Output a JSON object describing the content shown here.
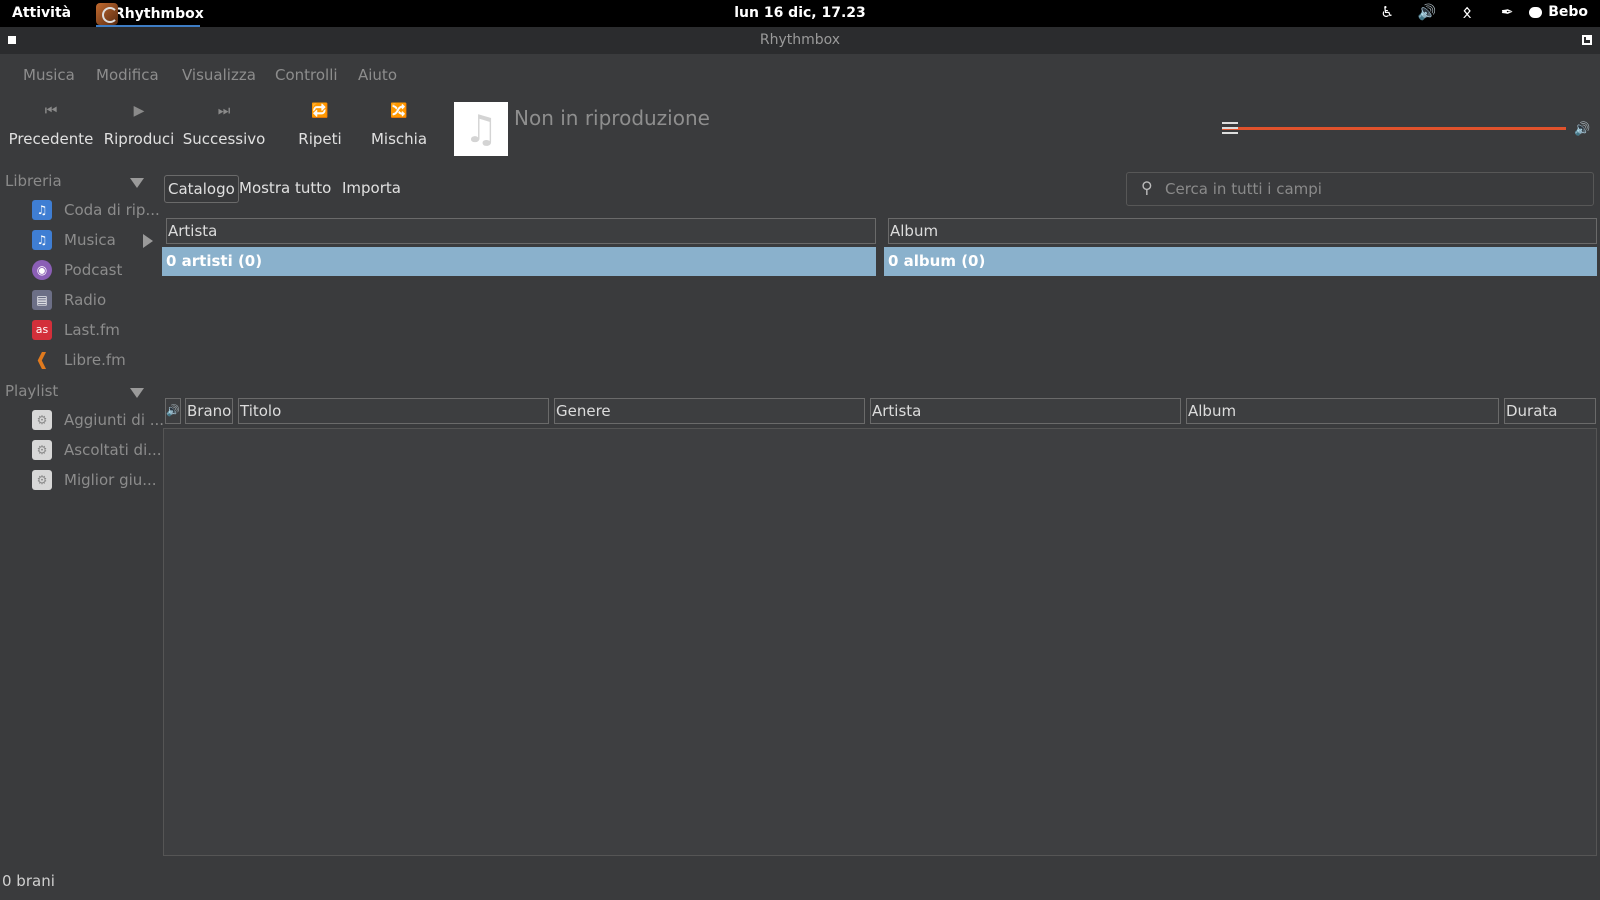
{
  "topbar": {
    "activities": "Attività",
    "app_name": "Rhythmbox",
    "clock": "lun 16 dic, 17.23",
    "user": "Bebo",
    "tray_icons": [
      "accessibility-icon",
      "volume-icon",
      "bluetooth-icon",
      "pen-icon"
    ]
  },
  "window": {
    "title": "Rhythmbox"
  },
  "menu": {
    "items": [
      "Musica",
      "Modifica",
      "Visualizza",
      "Controlli",
      "Aiuto"
    ]
  },
  "toolbar": {
    "prev_label": "Precedente",
    "play_label": "Riproduci",
    "next_label": "Successivo",
    "repeat_label": "Ripeti",
    "shuffle_label": "Mischia",
    "now_playing": "Non in riproduzione",
    "volume": 1.0,
    "accent_color": "#e0522c"
  },
  "sidebar": {
    "library_header": "Libreria",
    "library_items": [
      {
        "label": "Coda di rip...",
        "icon": "music-note-icon",
        "color": "#3f7ed3"
      },
      {
        "label": "Musica",
        "icon": "music-note-icon",
        "color": "#3f7ed3"
      },
      {
        "label": "Podcast",
        "icon": "podcast-icon",
        "color": "#8b5fb6"
      },
      {
        "label": "Radio",
        "icon": "radio-icon",
        "color": "#6c6f86"
      },
      {
        "label": "Last.fm",
        "icon": "lastfm-icon",
        "color": "#d32f3a"
      },
      {
        "label": "Libre.fm",
        "icon": "wifi-icon",
        "color": "#e07a1e"
      }
    ],
    "playlist_header": "Playlist",
    "playlist_items": [
      {
        "label": "Aggiunti di ...",
        "icon": "gear-icon"
      },
      {
        "label": "Ascoltati di...",
        "icon": "gear-icon"
      },
      {
        "label": "Miglior giu...",
        "icon": "gear-icon"
      }
    ]
  },
  "browser": {
    "tabs": [
      "Catalogo",
      "Mostra tutto",
      "Importa"
    ],
    "search_placeholder": "Cerca in tutti i campi",
    "artist_header": "Artista",
    "artist_row": "0 artisti (0)",
    "album_header": "Album",
    "album_row": "0 album (0)",
    "selection_color": "#8ab1cc"
  },
  "tracklist": {
    "columns": [
      "Brano",
      "Titolo",
      "Genere",
      "Artista",
      "Album",
      "Durata"
    ]
  },
  "status": {
    "text": "0 brani"
  }
}
